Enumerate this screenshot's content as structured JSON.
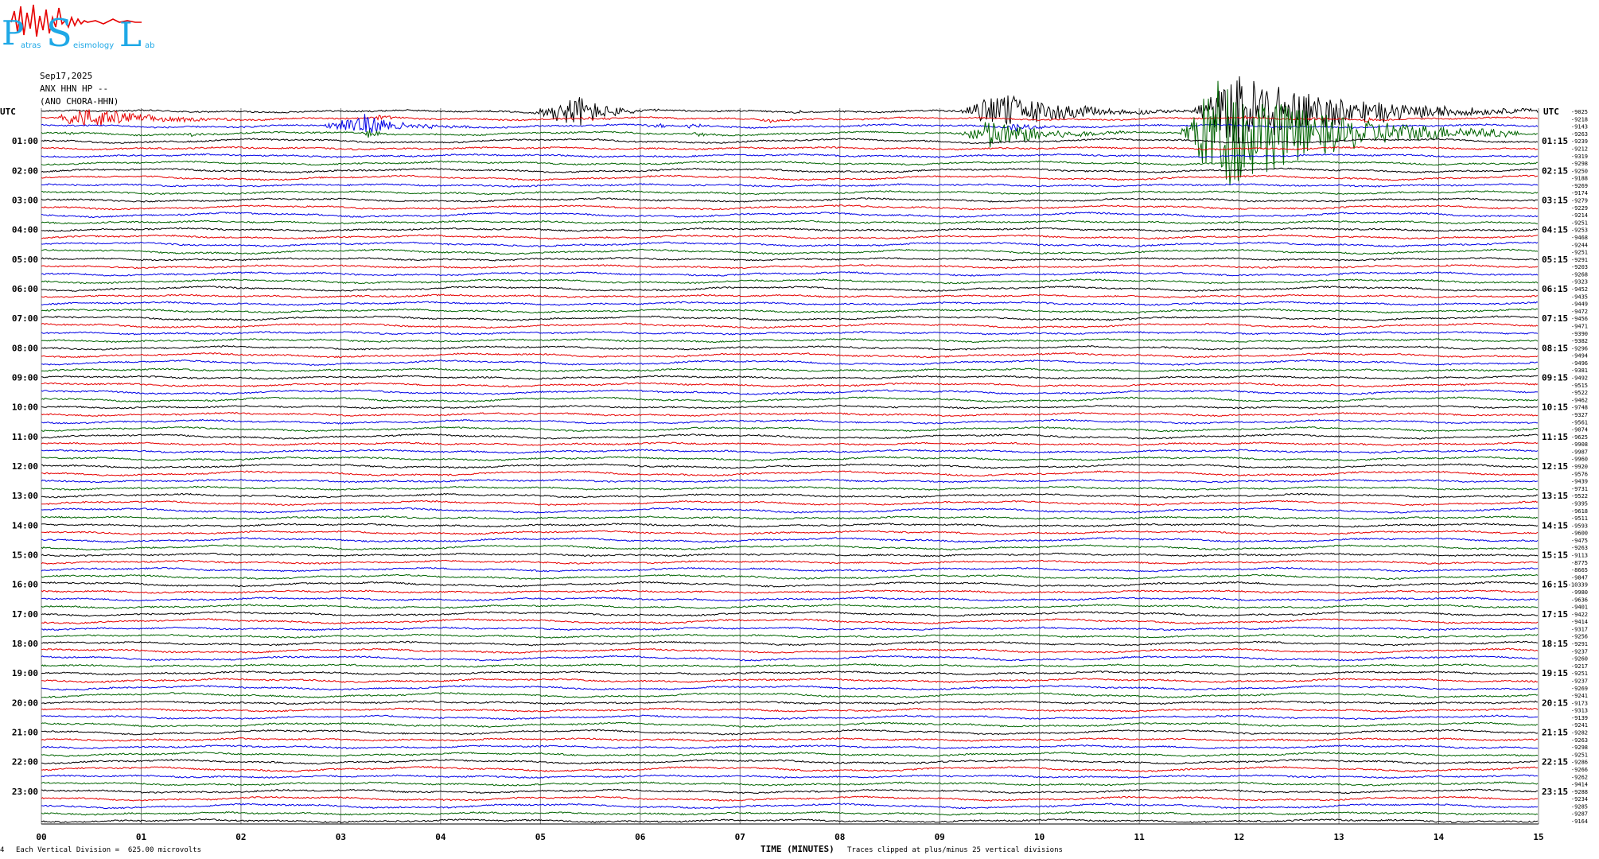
{
  "logo": {
    "letters": "PSL",
    "small_words": [
      "atras",
      "eismology",
      "ab"
    ]
  },
  "header": {
    "date": "Sep17,2025",
    "station": "ANX HHN HP --",
    "location": "(ANO CHORA-HHN)"
  },
  "chart_data": {
    "type": "line",
    "title": "",
    "xlabel": "TIME (MINUTES)",
    "ylabel": "",
    "x_range": [
      0,
      15
    ],
    "x_ticks": [
      "00",
      "01",
      "02",
      "03",
      "04",
      "05",
      "06",
      "07",
      "08",
      "09",
      "10",
      "11",
      "12",
      "13",
      "14",
      "15"
    ],
    "grid": true,
    "trace_colors": [
      "#000000",
      "#e60000",
      "#0000e6",
      "#006400"
    ],
    "left_axis_title": "UTC",
    "right_axis_title": "UTC",
    "left_hour_labels": [
      "01:00",
      "02:00",
      "03:00",
      "04:00",
      "05:00",
      "06:00",
      "07:00",
      "08:00",
      "09:00",
      "10:00",
      "11:00",
      "12:00",
      "13:00",
      "14:00",
      "15:00",
      "16:00",
      "17:00",
      "18:00",
      "19:00",
      "20:00",
      "21:00",
      "22:00",
      "23:00"
    ],
    "right_hour_labels": [
      "01:15",
      "02:15",
      "03:15",
      "04:15",
      "05:15",
      "06:15",
      "07:15",
      "08:15",
      "09:15",
      "10:15",
      "11:15",
      "12:15",
      "13:15",
      "14:15",
      "15:15",
      "16:15",
      "17:15",
      "18:15",
      "19:15",
      "20:15",
      "21:15",
      "22:15",
      "23:15"
    ],
    "trace_offsets": [
      "-9025",
      "-9218",
      "-9143",
      "-9263",
      "-9239",
      "-9212",
      "-9319",
      "-9298",
      "-9250",
      "-9188",
      "-9269",
      "-9174",
      "-9279",
      "-9229",
      "-9214",
      "-9251",
      "-9253",
      "-9468",
      "-9244",
      "-9251",
      "-9291",
      "-9203",
      "-9268",
      "-9323",
      "-9452",
      "-9435",
      "-9449",
      "-9472",
      "-9456",
      "-9471",
      "-9390",
      "-9382",
      "-9296",
      "-9494",
      "-9496",
      "-9381",
      "-9492",
      "-9515",
      "-9522",
      "-9462",
      "-9748",
      "-9327",
      "-9561",
      "-9074",
      "-9625",
      "-9908",
      "-9987",
      "-9960",
      "-9920",
      "-9576",
      "-9439",
      "-9731",
      "-9522",
      "-9395",
      "-9618",
      "-9511",
      "-9593",
      "-9600",
      "-9475",
      "-9263",
      "-9113",
      "-8775",
      "-8665",
      "-9847",
      "-10339",
      "-9980",
      "-9636",
      "-9401",
      "-9422",
      "-9414",
      "-9317",
      "-9256",
      "-9291",
      "-9237",
      "-9260",
      "-9217",
      "-9251",
      "-9237",
      "-9269",
      "-9241",
      "-9173",
      "-9313",
      "-9139",
      "-9241",
      "-9282",
      "-9263",
      "-9298",
      "-9251",
      "-9286",
      "-9266",
      "-9262",
      "-9414",
      "-9288",
      "-9234",
      "-9285",
      "-9287",
      "-9164"
    ],
    "events": [
      {
        "trace": 0,
        "start_min": 11.5,
        "end_min": 15.0,
        "peak_min": 12.0,
        "amplitude": 5.0
      },
      {
        "trace": 3,
        "start_min": 0.2,
        "end_min": 0.5,
        "peak_min": 0.3,
        "amplitude": 0.2
      },
      {
        "trace": 2,
        "start_min": 6.0,
        "end_min": 6.6,
        "peak_min": 6.2,
        "amplitude": 0.3
      },
      {
        "trace": 2,
        "start_min": 9.6,
        "end_min": 10.3,
        "peak_min": 9.8,
        "amplitude": 0.6
      },
      {
        "trace": 1,
        "start_min": 12.7,
        "end_min": 12.9,
        "peak_min": 12.8,
        "amplitude": 0.3
      },
      {
        "trace": 0,
        "start_min": 9.5,
        "end_min": 9.8,
        "peak_min": 9.6,
        "amplitude": 0.25
      },
      {
        "trace": 0,
        "start_min": 13.3,
        "end_min": 13.6,
        "peak_min": 13.4,
        "amplitude": 0.25
      },
      {
        "trace": 1,
        "start_min": 0.1,
        "end_min": 2.0,
        "peak_min": 0.5,
        "amplitude": 1.5
      },
      {
        "trace": 3,
        "start_min": 11.4,
        "end_min": 14.8,
        "peak_min": 11.8,
        "amplitude": 8.0
      },
      {
        "trace": 0,
        "start_min": 7.5,
        "end_min": 7.7,
        "peak_min": 7.6,
        "amplitude": 0.2
      },
      {
        "trace": 1,
        "start_min": 0.2,
        "end_min": 0.6,
        "peak_min": 0.35,
        "amplitude": 0.4
      },
      {
        "trace": 1,
        "start_min": 7.1,
        "end_min": 7.6,
        "peak_min": 7.3,
        "amplitude": 0.3
      },
      {
        "trace": 3,
        "start_min": 9.2,
        "end_min": 11.0,
        "peak_min": 9.5,
        "amplitude": 2.2
      },
      {
        "trace": 1,
        "start_min": 7.3,
        "end_min": 7.6,
        "peak_min": 7.4,
        "amplitude": 0.3
      },
      {
        "trace": 0,
        "start_min": 4.9,
        "end_min": 6.2,
        "peak_min": 5.4,
        "amplitude": 2.2
      },
      {
        "trace": 3,
        "start_min": 0.7,
        "end_min": 0.9,
        "peak_min": 0.8,
        "amplitude": 0.2
      },
      {
        "trace": 1,
        "start_min": 5.2,
        "end_min": 6.0,
        "peak_min": 5.5,
        "amplitude": 0.2
      },
      {
        "trace": 0,
        "start_min": 9.2,
        "end_min": 11.5,
        "peak_min": 9.6,
        "amplitude": 2.6
      },
      {
        "trace": 2,
        "start_min": 2.8,
        "end_min": 4.3,
        "peak_min": 3.2,
        "amplitude": 1.6
      },
      {
        "trace": 1,
        "start_min": 3.3,
        "end_min": 3.7,
        "peak_min": 3.4,
        "amplitude": 0.4
      },
      {
        "trace": 3,
        "start_min": 3.4,
        "end_min": 3.5,
        "peak_min": 3.45,
        "amplitude": 0.2
      },
      {
        "trace": 1,
        "start_min": 12.0,
        "end_min": 12.2,
        "peak_min": 12.1,
        "amplitude": 0.2
      },
      {
        "trace": 0,
        "start_min": 12.5,
        "end_min": 14.0,
        "peak_min": 12.7,
        "amplitude": 0.9
      },
      {
        "trace": 0,
        "start_min": 12.6,
        "end_min": 13.2,
        "peak_min": 12.8,
        "amplitude": 0.4
      },
      {
        "trace": 1,
        "start_min": 13.2,
        "end_min": 13.6,
        "peak_min": 13.3,
        "amplitude": 0.3
      },
      {
        "trace": 3,
        "start_min": 6.5,
        "end_min": 6.9,
        "peak_min": 6.6,
        "amplitude": 0.3
      },
      {
        "trace": 3,
        "start_min": 1.4,
        "end_min": 2.0,
        "peak_min": 1.5,
        "amplitude": 0.3
      },
      {
        "trace": 3,
        "start_min": 3.2,
        "end_min": 3.5,
        "peak_min": 3.3,
        "amplitude": 0.8
      },
      {
        "trace": 2,
        "start_min": 6.4,
        "end_min": 6.8,
        "peak_min": 6.5,
        "amplitude": 0.5
      },
      {
        "trace": 3,
        "start_min": 12.1,
        "end_min": 12.7,
        "peak_min": 12.3,
        "amplitude": 0.4
      },
      {
        "trace": 0,
        "start_min": 14.7,
        "end_min": 15.0,
        "peak_min": 14.8,
        "amplitude": 0.3
      }
    ]
  },
  "footer": {
    "division": "Each Vertical Division =  625.00 microvolts",
    "clip_note": "Traces clipped at plus/minus 25 vertical divisions",
    "corner_mark": "4"
  }
}
